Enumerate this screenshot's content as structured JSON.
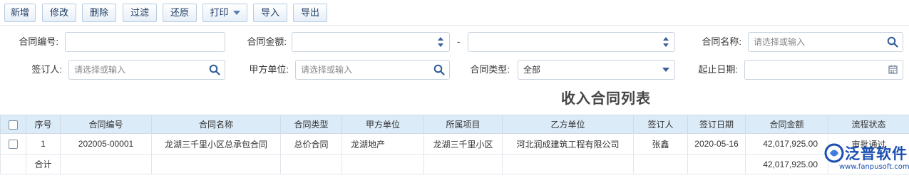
{
  "toolbar": {
    "add": "新增",
    "edit": "修改",
    "delete": "删除",
    "filter": "过滤",
    "restore": "还原",
    "print": "打印",
    "import": "导入",
    "export": "导出"
  },
  "filters": {
    "contract_no_label": "合同编号:",
    "contract_no_value": "",
    "amount_label": "合同金额:",
    "amount_from": "",
    "amount_dash": "-",
    "amount_to": "",
    "contract_name_label": "合同名称:",
    "contract_name_placeholder": "请选择或输入",
    "signer_label": "签订人:",
    "signer_placeholder": "请选择或输入",
    "party_a_label": "甲方单位:",
    "party_a_placeholder": "请选择或输入",
    "type_label": "合同类型:",
    "type_value": "全部",
    "date_label": "起止日期:",
    "date_value": ""
  },
  "table": {
    "title": "收入合同列表",
    "columns": [
      "序号",
      "合同编号",
      "合同名称",
      "合同类型",
      "甲方单位",
      "所属项目",
      "乙方单位",
      "签订人",
      "签订日期",
      "合同金额",
      "流程状态"
    ],
    "rows": [
      {
        "seq": "1",
        "contract_no": "202005-00001",
        "contract_name": "龙湖三千里小区总承包合同",
        "contract_type": "总价合同",
        "party_a": "龙湖地产",
        "project": "龙湖三千里小区",
        "party_b": "河北润成建筑工程有限公司",
        "signer": "张鑫",
        "sign_date": "2020-05-16",
        "amount": "42,017,925.00",
        "status": "审批通过"
      }
    ],
    "summary": {
      "label": "合计",
      "amount": "42,017,925.00"
    }
  },
  "watermark": {
    "brand": "泛普软件",
    "url": "www.fanpusoft.com"
  },
  "colors": {
    "header_bg": "#dcebf8",
    "link": "#1b5fb6",
    "status_ok": "#2c9a2c",
    "accent": "#1a4fb0"
  }
}
